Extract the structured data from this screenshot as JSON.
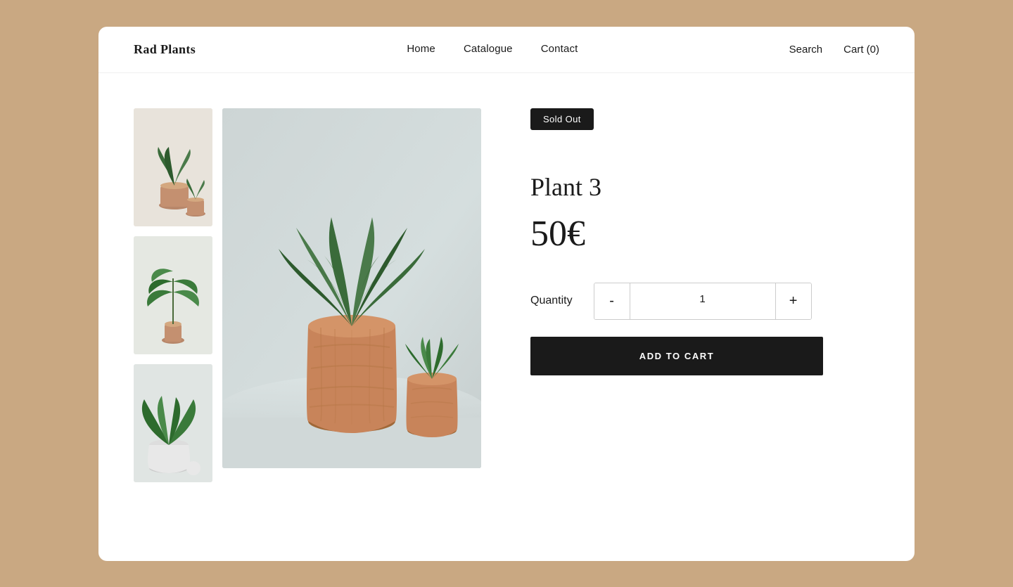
{
  "brand": {
    "name": "Rad Plants"
  },
  "nav": {
    "items": [
      {
        "label": "Home",
        "href": "#"
      },
      {
        "label": "Catalogue",
        "href": "#"
      },
      {
        "label": "Contact",
        "href": "#"
      }
    ]
  },
  "header_actions": {
    "search_label": "Search",
    "cart_label": "Cart (0)"
  },
  "product": {
    "badge": "Sold Out",
    "name": "Plant 3",
    "price": "50€",
    "quantity_label": "Quantity",
    "quantity_value": "1",
    "qty_minus": "-",
    "qty_plus": "+",
    "add_to_cart_label": "ADD TO CART"
  },
  "colors": {
    "background": "#c9a882",
    "white": "#ffffff",
    "black": "#1a1a1a",
    "badge_bg": "#1a1a1a",
    "badge_text": "#ffffff"
  }
}
